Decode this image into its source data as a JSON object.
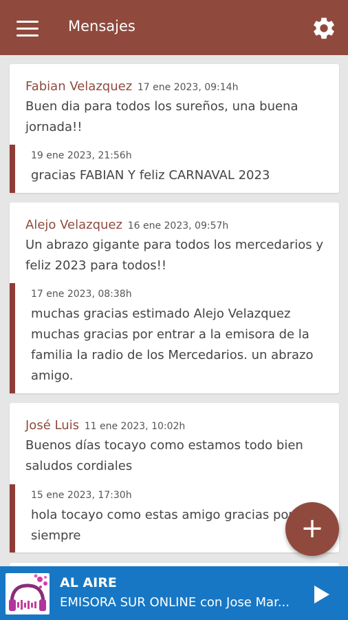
{
  "topbar": {
    "title": "Mensajes",
    "menu_icon": "hamburger-menu-icon",
    "settings_icon": "gear-icon",
    "color": "#8f4a3d"
  },
  "messages": [
    {
      "author": "Fabian Velazquez",
      "date": "17 ene 2023, 09:14h",
      "text": "Buen dia para todos los sureños, una buena jornada!!",
      "reply": {
        "date": "19 ene 2023, 21:56h",
        "text": "gracias FABIAN Y feliz CARNAVAL 2023"
      }
    },
    {
      "author": "Alejo Velazquez",
      "date": "16 ene 2023, 09:57h",
      "text": "Un abrazo gigante para todos los mercedarios y feliz 2023 para todos!!",
      "reply": {
        "date": "17 ene 2023, 08:38h",
        "text": "muchas gracias estimado Alejo Velazquez muchas gracias por entrar a la emisora de la familia la radio de los Mercedarios. un abrazo amigo."
      }
    },
    {
      "author": "José Luis",
      "date": "11 ene 2023, 10:02h",
      "text": "Buenos días tocayo  como estamos  todo bien saludos cordiales",
      "reply": {
        "date": "15 ene 2023, 17:30h",
        "text": "hola tocayo como estas amigo gracias por estar siempre"
      }
    }
  ],
  "fab": {
    "label": "+",
    "icon": "plus-icon"
  },
  "player": {
    "status": "AL AIRE",
    "station": "EMISORA SUR ONLINE con Jose Mar...",
    "play_icon": "play-icon",
    "color": "#1777c4"
  }
}
